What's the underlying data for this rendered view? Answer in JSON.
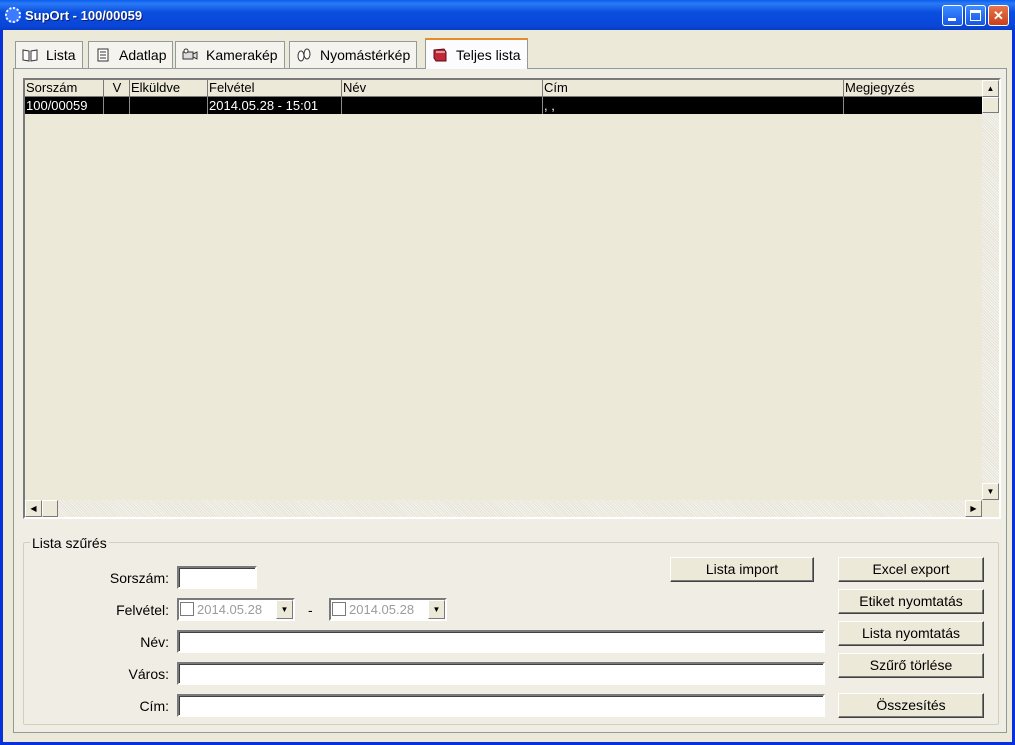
{
  "window": {
    "title": "SupOrt - 100/00059"
  },
  "tabs": [
    {
      "label": "Lista",
      "icon": "book-icon"
    },
    {
      "label": "Adatlap",
      "icon": "clipboard-icon"
    },
    {
      "label": "Kamerakép",
      "icon": "camera-icon"
    },
    {
      "label": "Nyomástérkép",
      "icon": "footprint-icon"
    },
    {
      "label": "Teljes lista",
      "icon": "red-book-icon"
    }
  ],
  "grid": {
    "columns": [
      "Sorszám",
      "V",
      "Elküldve",
      "Felvétel",
      "Név",
      "Cím",
      "Megjegyzés"
    ],
    "rows": [
      [
        "100/00059",
        "",
        "",
        "2014.05.28 - 15:01",
        "",
        ", ,",
        ""
      ]
    ]
  },
  "filter": {
    "legend": "Lista szűrés",
    "labels": {
      "sorszam": "Sorszám:",
      "felvetel": "Felvétel:",
      "nev": "Név:",
      "varos": "Város:",
      "cim": "Cím:"
    },
    "date_from": "2014.05.28",
    "date_to": "2014.05.28",
    "date_separator": "-",
    "buttons": {
      "lista_import": "Lista import",
      "excel_export": "Excel export",
      "etiket_nyomtatas": "Etiket nyomtatás",
      "lista_nyomtatas": "Lista nyomtatás",
      "szuro_torlese": "Szűrő törlése",
      "osszesites": "Összesítés"
    }
  }
}
